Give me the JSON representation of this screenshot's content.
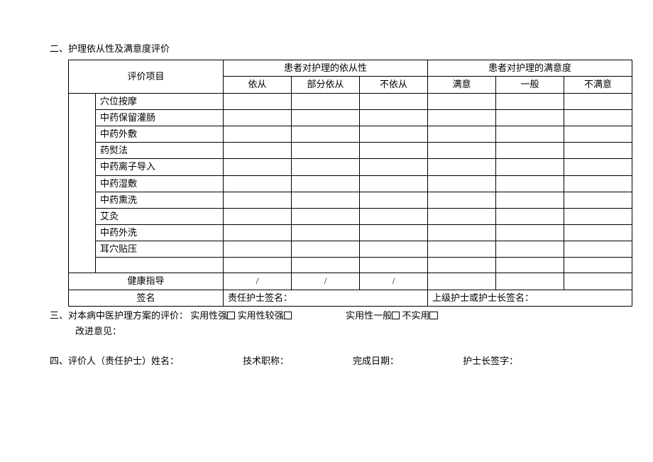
{
  "section2": {
    "title": "二、护理依从性及满意度评价",
    "header": {
      "eval_item": "评价项目",
      "compliance": "患者对护理的依从性",
      "satisfaction": "患者对护理的满意度",
      "compliance_cols": [
        "依从",
        "部分依从",
        "不依从"
      ],
      "satisfaction_cols": [
        "满意",
        "一般",
        "不满意"
      ]
    },
    "rows": [
      "穴位按摩",
      "中药保留灌肠",
      "中药外敷",
      "药熨法",
      "中药离子导入",
      "中药湿敷",
      "中药熏洗",
      "艾灸",
      "中药外洗",
      "耳穴贴压",
      ""
    ],
    "health_guidance": "健康指导",
    "slash": "/",
    "signature_row_label": "签名",
    "responsible_nurse_label": "责任护士签名：",
    "senior_nurse_label": "上级护士或护士长签名："
  },
  "section3": {
    "prefix": "三、对本病中医护理方案的评价：",
    "opts": {
      "strong": "实用性强",
      "fairly_strong": "实用性较强",
      "average": "实用性一般",
      "not_practical": "不实用"
    },
    "improve_label": "改进意见："
  },
  "section4": {
    "prefix": "四、",
    "evaluator_label": "评价人（责任护士）姓名：",
    "title_label": "技术职称：",
    "date_label": "完成日期：",
    "head_nurse_label": "护士长签字："
  }
}
